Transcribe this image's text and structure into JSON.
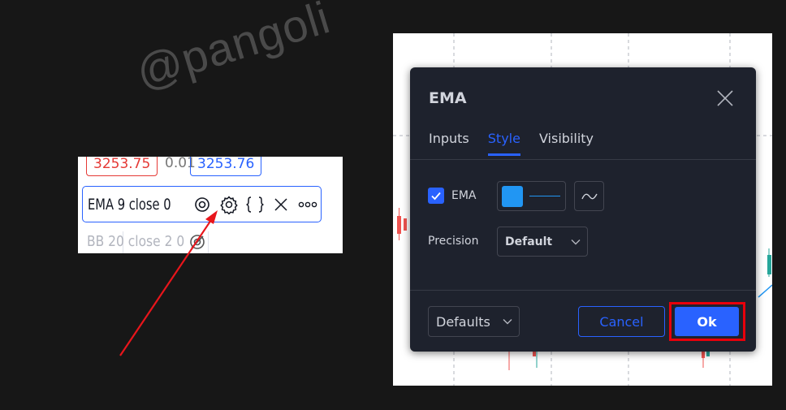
{
  "watermark": "@pangoli",
  "legend": {
    "price_red": "3253.75",
    "price_mid": "0.01",
    "price_blue": "3253.76",
    "ema_label": "EMA 9 close 0",
    "bb_label": "BB 20 close 2 0",
    "icons": [
      "eye-icon",
      "gear-icon",
      "braces-icon",
      "close-icon",
      "more-icon"
    ]
  },
  "dialog": {
    "title": "EMA",
    "tabs": [
      {
        "label": "Inputs",
        "active": false
      },
      {
        "label": "Style",
        "active": true
      },
      {
        "label": "Visibility",
        "active": false
      }
    ],
    "ema_checkbox_label": "EMA",
    "ema_checked": true,
    "line_color": "#2196f3",
    "precision_label": "Precision",
    "precision_value": "Default",
    "defaults_label": "Defaults",
    "cancel_label": "Cancel",
    "ok_label": "Ok"
  },
  "colors": {
    "accent": "#2962ff",
    "highlight": "#e8000b",
    "dialog_bg": "#1e222d",
    "bearish": "#ef5350",
    "bullish": "#26a69a"
  }
}
